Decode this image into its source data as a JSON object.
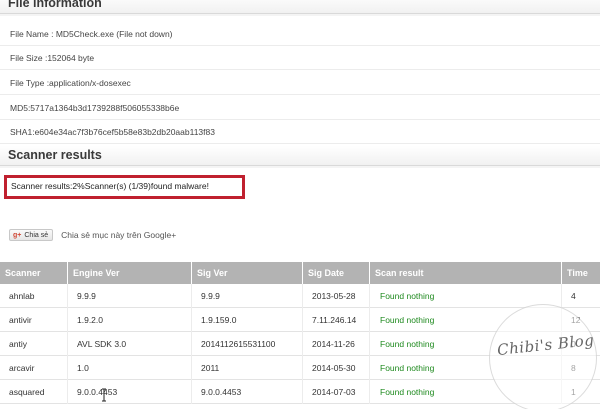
{
  "file_info": {
    "heading": "File information",
    "rows": [
      "File Name : MD5Check.exe (File not down)",
      "File Size :152064 byte",
      "File Type :application/x-dosexec",
      "MD5:5717a1364b3d1739288f506055338b6e",
      "SHA1:e604e34ac7f3b76cef5b58e83b2db20aab113f83"
    ]
  },
  "scanner": {
    "heading": "Scanner results",
    "summary": "Scanner results:2%Scanner(s) (1/39)found malware!"
  },
  "share": {
    "button_label": "Chia sẻ",
    "gplus_glyph": "g+",
    "text": "Chia sẻ mục này trên Google+"
  },
  "table": {
    "headers": [
      "Scanner",
      "Engine Ver",
      "Sig Ver",
      "Sig Date",
      "Scan result",
      "Time"
    ],
    "rows": [
      [
        "ahnlab",
        "9.9.9",
        "9.9.9",
        "2013-05-28",
        "Found nothing",
        "4"
      ],
      [
        "antivir",
        "1.9.2.0",
        "1.9.159.0",
        "7.11.246.14",
        "Found nothing",
        "12"
      ],
      [
        "antiy",
        "AVL SDK 3.0",
        "2014112615531100",
        "2014-11-26",
        "Found nothing",
        "0"
      ],
      [
        "arcavir",
        "1.0",
        "2011",
        "2014-05-30",
        "Found nothing",
        "8"
      ],
      [
        "asquared",
        "9.0.0.4453",
        "9.0.0.4453",
        "2014-07-03",
        "Found nothing",
        "1"
      ]
    ]
  },
  "watermark": {
    "text": "Chibi's Blog"
  },
  "colors": {
    "result_border": "#c0202f",
    "found_text": "#1f8a1f",
    "table_header": "#b3b3b3"
  }
}
